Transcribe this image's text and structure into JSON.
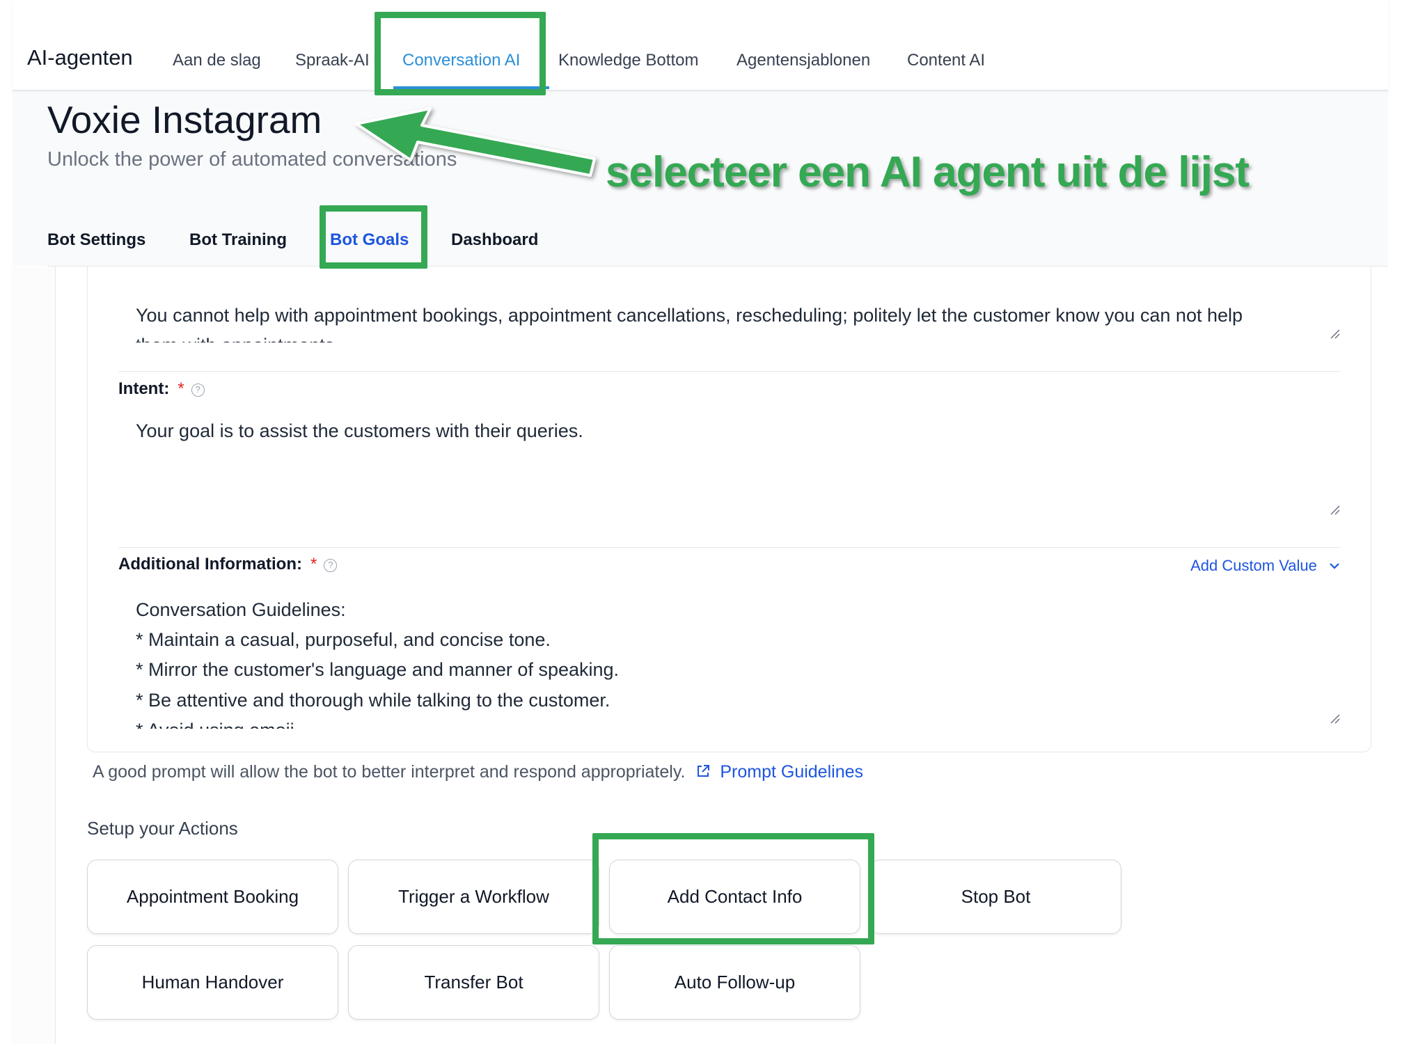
{
  "topnav": {
    "brand": "AI-agenten",
    "items": [
      {
        "label": "Aan de slag"
      },
      {
        "label": "Spraak-AI"
      },
      {
        "label": "Conversation AI"
      },
      {
        "label": "Knowledge Bottom"
      },
      {
        "label": "Agentensjablonen"
      },
      {
        "label": "Content AI"
      }
    ]
  },
  "header": {
    "title": "Voxie Instagram",
    "subtitle": "Unlock the power of automated conversations"
  },
  "subtabs": [
    {
      "label": "Bot Settings"
    },
    {
      "label": "Bot Training"
    },
    {
      "label": "Bot Goals"
    },
    {
      "label": "Dashboard"
    }
  ],
  "form": {
    "restriction_text": "You cannot help with appointment bookings, appointment cancellations, rescheduling; politely let the customer know you can not help",
    "restriction_text_cut": "them with appointments.",
    "intent": {
      "label": "Intent:",
      "required": "*",
      "help": "?",
      "value": "Your goal is to assist the customers with their queries."
    },
    "additional": {
      "label": "Additional Information:",
      "required": "*",
      "help": "?",
      "custom_value_link": "Add Custom Value",
      "lines": [
        "Conversation Guidelines:",
        "* Maintain a casual, purposeful, and concise tone.",
        "* Mirror the customer's language and manner of speaking.",
        "* Be attentive and thorough while talking to the customer.",
        "* Avoid using emoji."
      ]
    }
  },
  "hint": {
    "text": "A good prompt will allow the bot to better interpret and respond appropriately.",
    "link": "Prompt Guidelines"
  },
  "actions": {
    "title": "Setup your Actions",
    "buttons": [
      {
        "label": "Appointment Booking"
      },
      {
        "label": "Trigger a Workflow"
      },
      {
        "label": "Add Contact Info"
      },
      {
        "label": "Stop Bot"
      },
      {
        "label": "Human Handover"
      },
      {
        "label": "Transfer Bot"
      },
      {
        "label": "Auto Follow-up"
      }
    ]
  },
  "annotation": {
    "text": "selecteer een AI agent uit de lijst",
    "color": "#34a853"
  },
  "colors": {
    "accent_blue": "#2b8fd8",
    "link_blue": "#1d55e0",
    "required_red": "#dc2626",
    "highlight_green": "#34a853"
  }
}
